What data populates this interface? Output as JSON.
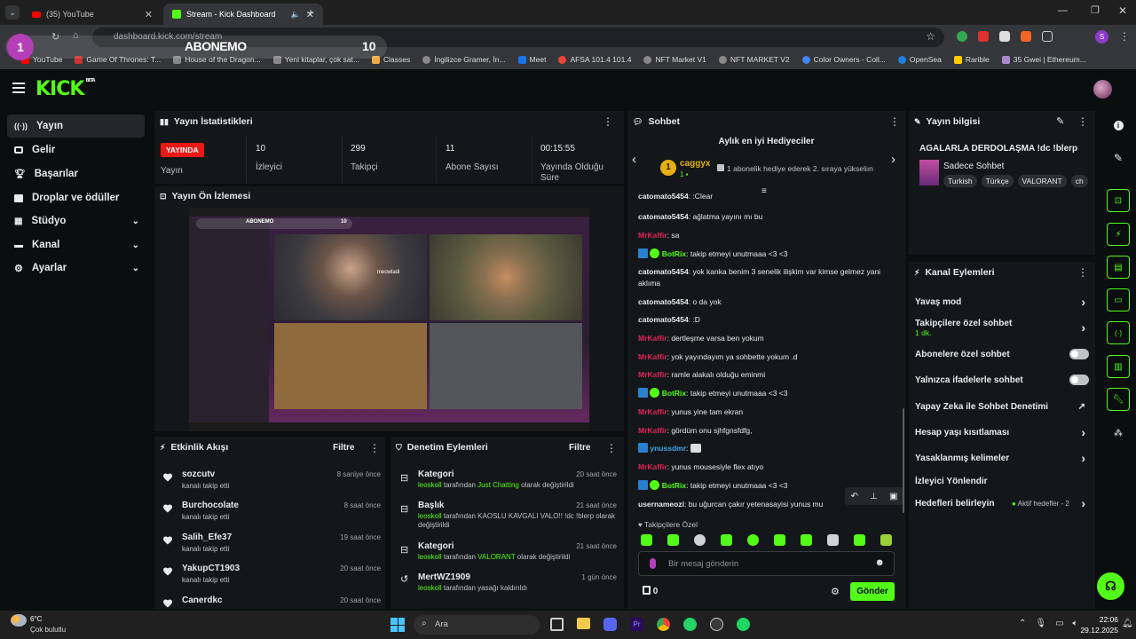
{
  "browser": {
    "tabs": [
      {
        "label": "(35) YouTube",
        "active": false
      },
      {
        "label": "Stream - Kick Dashboard",
        "active": true
      }
    ],
    "url": "dashboard.kick.com/stream",
    "bookmarks": [
      "YouTube",
      "Game Of Thrones: T...",
      "House of the Dragon...",
      "Yeni kitaplar, çok sat...",
      "Classes",
      "İngilizce Gramer, İn...",
      "Meet",
      "AFSA 101.4 101.4",
      "NFT Market V1",
      "NFT MARKET V2",
      "Color Owners - Coll...",
      "OpenSea",
      "Rarible",
      "35 Gwei | Ethereum..."
    ]
  },
  "overlay": {
    "badge": "1",
    "title": "ABONEMO",
    "count": "10"
  },
  "kick": {
    "logo": "KICK",
    "logo_sup": "BETA"
  },
  "sidebar": {
    "items": [
      {
        "label": "Yayın",
        "icon": "broadcast-icon"
      },
      {
        "label": "Gelir",
        "icon": "wallet-icon"
      },
      {
        "label": "Başarılar",
        "icon": "trophy-icon"
      },
      {
        "label": "Droplar ve ödüller",
        "icon": "gift-icon"
      },
      {
        "label": "Stüdyo",
        "icon": "grid-icon"
      },
      {
        "label": "Kanal",
        "icon": "channel-icon"
      },
      {
        "label": "Ayarlar",
        "icon": "gear-icon"
      }
    ]
  },
  "stats": {
    "title": "Yayın İstatistikleri",
    "live_badge": "YAYINDA",
    "live_label": "Yayın",
    "viewers": "10",
    "viewers_label": "İzleyici",
    "followers": "299",
    "followers_label": "Takipçi",
    "subs": "11",
    "subs_label": "Abone Sayısı",
    "uptime": "00:15:55",
    "uptime_label": "Yayında Olduğu Süre"
  },
  "preview": {
    "title": "Yayın Ön İzlemesi",
    "overlay_title": "ABONEMO",
    "overlay_count": "10",
    "cam_name": "meowladi"
  },
  "activity": {
    "title": "Etkinlik Akışı",
    "filter": "Filtre",
    "items": [
      {
        "name": "sozcutv",
        "sub": "kanalı takip etti",
        "time": "8 saniye önce"
      },
      {
        "name": "Burchocolate",
        "sub": "kanalı takip etti",
        "time": "8 saat önce"
      },
      {
        "name": "Salih_Efe37",
        "sub": "kanalı takip etti",
        "time": "19 saat önce"
      },
      {
        "name": "YakupCT1903",
        "sub": "kanalı takip etti",
        "time": "20 saat önce"
      },
      {
        "name": "Canerdkc",
        "sub": "",
        "time": "20 saat önce"
      }
    ]
  },
  "mod": {
    "title": "Denetim Eylemleri",
    "filter": "Filtre",
    "items": [
      {
        "name": "Kategori",
        "user": "leoskoll",
        "mid": " tarafından ",
        "hl": "Just Chatting",
        "end": " olarak değiştirildi",
        "time": "20 saat önce"
      },
      {
        "name": "Başlık",
        "user": "leoskoll",
        "mid": " tarafından ",
        "hl": "",
        "end": "KAOSLU KAVGALI VALO!! !dc !blerp olarak değiştirildi",
        "time": "21 saat önce"
      },
      {
        "name": "Kategori",
        "user": "leoskoll",
        "mid": " tarafından ",
        "hl": "VALORANT",
        "end": " olarak değiştirildi",
        "time": "21 saat önce"
      },
      {
        "name": "MertWZ1909",
        "user": "leoskoll",
        "mid": " tarafından yasağı kaldırıldı",
        "hl": "",
        "end": "",
        "time": "1 gün önce"
      }
    ]
  },
  "chat": {
    "title": "Sohbet",
    "gifters_title": "Aylık en iyi Hediyeciler",
    "gifter_name": "caggyx",
    "gifter_count": "1",
    "gifter_note": "1 abonelik hediye ederek 2. sıraya yükseliın",
    "messages": [
      {
        "user": "catomato5454",
        "color": "white",
        "text": ":Clear",
        "bot": false
      },
      {
        "user": "catomato5454",
        "color": "white",
        "text": "ağlatma yayını mı bu",
        "bot": false
      },
      {
        "user": "MrKaffir",
        "color": "red",
        "text": "sa",
        "bot": false
      },
      {
        "user": "BotRix",
        "color": "green",
        "text": "takip etmeyi unutmaaa <3 <3",
        "bot": true
      },
      {
        "user": "catomato5454",
        "color": "white",
        "text": "yok kanka benim 3 senelik ilişkim var kimse gelmez yani aklıma",
        "bot": false
      },
      {
        "user": "catomato5454",
        "color": "white",
        "text": "o da yok",
        "bot": false
      },
      {
        "user": "catomato5454",
        "color": "white",
        "text": ":D",
        "bot": false
      },
      {
        "user": "MrKaffir",
        "color": "red",
        "text": "dertleşme varsa ben yokum",
        "bot": false
      },
      {
        "user": "MrKaffir",
        "color": "red",
        "text": "yok yayındayım ya sohbette yokum .d",
        "bot": false
      },
      {
        "user": "MrKaffir",
        "color": "red",
        "text": "ramle alakalı olduğu eminmi",
        "bot": false
      },
      {
        "user": "BotRix",
        "color": "green",
        "text": "takip etmeyi unutmaaa <3 <3",
        "bot": true
      },
      {
        "user": "MrKaffir",
        "color": "red",
        "text": "yunus yine tam ekran",
        "bot": false
      },
      {
        "user": "MrKaffir",
        "color": "red",
        "text": "gördüm onu sjhfgnsfdfg,",
        "bot": false
      },
      {
        "user": "ynussdmr",
        "color": "blue",
        "text": "",
        "bot": true
      },
      {
        "user": "MrKaffir",
        "color": "red",
        "text": "yunus mousesiyle flex atıyo",
        "bot": false
      },
      {
        "user": "BotRix",
        "color": "green",
        "text": "takip etmeyi unutmaaa <3 <3",
        "bot": true
      },
      {
        "user": "usernameozi",
        "color": "white",
        "text": "bu uğurcan çakır yetenasayisi yunus mu",
        "bot": false
      }
    ],
    "follower_only": "Takipçilere Özel",
    "input_placeholder": "Bir mesaj gönderin",
    "points": "0",
    "send": "Gönder"
  },
  "info": {
    "title": "Yayın bilgisi",
    "stream_title": "AGALARLA DERDOLAŞMA !dc !blerp",
    "category": "Sadece Sohbet",
    "tags": [
      "Turkish",
      "Türkçe",
      "VALORANT",
      "ch"
    ]
  },
  "actions": {
    "title": "Kanal Eylemleri",
    "slow": "Yavaş mod",
    "followers_only": "Takipçilere özel sohbet",
    "followers_only_sub": "1 dk.",
    "subs_only": "Abonelere özel sohbet",
    "emote_only": "Yalnızca ifadelerle sohbet",
    "ai_mod": "Yapay Zeka ile Sohbet Denetimi",
    "age": "Hesap yaşı kısıtlaması",
    "banned_words": "Yasaklanmış kelimeler",
    "redirect": "İzleyici Yönlendir",
    "goals": "Hedefleri belirleyin",
    "goals_status": "Aktif hedefler - 2"
  },
  "taskbar": {
    "temp": "6°C",
    "weather": "Çok bulutlu",
    "search": "Ara",
    "time": "22:06",
    "date": "29.12.2025"
  },
  "colors": {
    "accent": "#53fc18",
    "live": "#e91916",
    "bg": "#0b0e0f",
    "panel": "#141719"
  }
}
